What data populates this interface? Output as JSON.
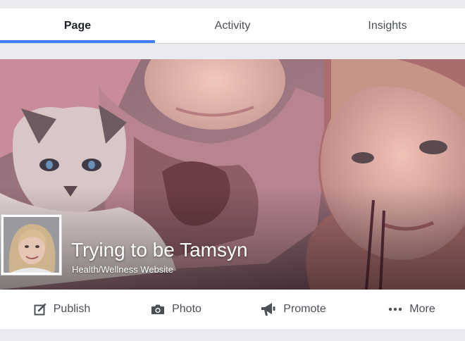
{
  "tabs": [
    {
      "label": "Page",
      "active": true
    },
    {
      "label": "Activity",
      "active": false
    },
    {
      "label": "Insights",
      "active": false
    }
  ],
  "page": {
    "name": "Trying to be Tamsyn",
    "category": "Health/Wellness Website"
  },
  "actions": [
    {
      "label": "Publish",
      "icon": "edit-icon"
    },
    {
      "label": "Photo",
      "icon": "camera-icon"
    },
    {
      "label": "Promote",
      "icon": "megaphone-icon"
    },
    {
      "label": "More",
      "icon": "ellipsis-icon"
    }
  ],
  "colors": {
    "accent": "#4080ff",
    "background": "#e9ebee",
    "text": "#4b4f56"
  }
}
